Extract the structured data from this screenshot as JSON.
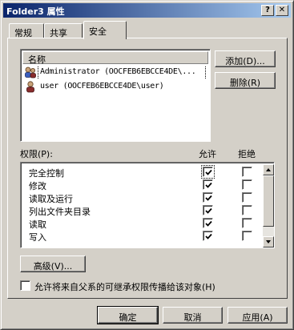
{
  "window": {
    "title": "Folder3 属性",
    "help_glyph": "?",
    "close_glyph": "✕"
  },
  "tabs": [
    {
      "label": "常规",
      "active": false
    },
    {
      "label": "共享",
      "active": false
    },
    {
      "label": "安全",
      "active": true
    }
  ],
  "users": {
    "header": "名称",
    "items": [
      {
        "text": "Administrator (OOCFEB6EBCCE4DE\\...",
        "icon": "users-group-icon",
        "selected": true
      },
      {
        "text": "user (OOCFEB6EBCCE4DE\\user)",
        "icon": "user-icon",
        "selected": false
      }
    ]
  },
  "buttons": {
    "add": "添加(D)...",
    "remove": "删除(R)",
    "advanced": "高级(V)...",
    "ok": "确定",
    "cancel": "取消",
    "apply": "应用(A)"
  },
  "permissions": {
    "label": "权限(P):",
    "allow_header": "允许",
    "deny_header": "拒绝",
    "items": [
      {
        "label": "完全控制",
        "allow": true,
        "deny": false
      },
      {
        "label": "修改",
        "allow": true,
        "deny": false
      },
      {
        "label": "读取及运行",
        "allow": true,
        "deny": false
      },
      {
        "label": "列出文件夹目录",
        "allow": true,
        "deny": false
      },
      {
        "label": "读取",
        "allow": true,
        "deny": false
      },
      {
        "label": "写入",
        "allow": true,
        "deny": false
      }
    ]
  },
  "inherit": {
    "label": "允许将来自父系的可继承权限传播给该对象(H)",
    "checked": false
  }
}
